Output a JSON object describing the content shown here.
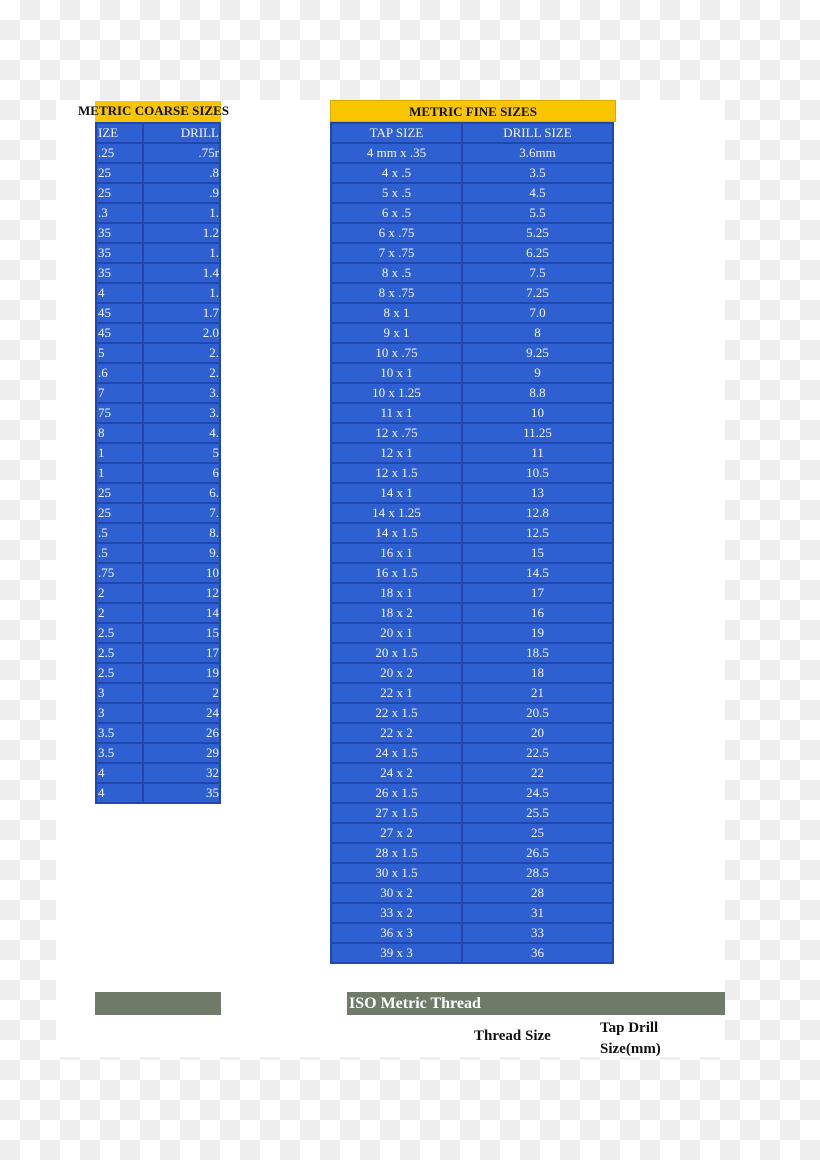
{
  "coarse": {
    "title": "METRIC COARSE SIZES",
    "header": [
      "IZE",
      "DRILL"
    ],
    "rows": [
      [
        ".25",
        ".75r"
      ],
      [
        "25",
        ".8"
      ],
      [
        "25",
        ".9"
      ],
      [
        ".3",
        "1."
      ],
      [
        "35",
        "1.2"
      ],
      [
        "35",
        "1."
      ],
      [
        "35",
        "1.4"
      ],
      [
        "4",
        "1."
      ],
      [
        "45",
        "1.7"
      ],
      [
        "45",
        "2.0"
      ],
      [
        "5",
        "2."
      ],
      [
        ".6",
        "2."
      ],
      [
        "7",
        "3."
      ],
      [
        "75",
        "3."
      ],
      [
        "8",
        "4."
      ],
      [
        "1",
        "5"
      ],
      [
        "1",
        "6"
      ],
      [
        "25",
        "6."
      ],
      [
        "25",
        "7."
      ],
      [
        ".5",
        "8."
      ],
      [
        ".5",
        "9."
      ],
      [
        ".75",
        "10"
      ],
      [
        "2",
        "12"
      ],
      [
        "2",
        "14"
      ],
      [
        "2.5",
        "15"
      ],
      [
        "2.5",
        "17"
      ],
      [
        "2.5",
        "19"
      ],
      [
        "3",
        "2"
      ],
      [
        "3",
        "24"
      ],
      [
        "3.5",
        "26"
      ],
      [
        "3.5",
        "29"
      ],
      [
        "4",
        "32"
      ],
      [
        "4",
        "35"
      ]
    ]
  },
  "fine": {
    "title": "METRIC FINE SIZES",
    "header": [
      "TAP SIZE",
      "DRILL SIZE"
    ],
    "rows": [
      [
        "4 mm x .35",
        "3.6mm"
      ],
      [
        "4 x .5",
        "3.5"
      ],
      [
        "5 x .5",
        "4.5"
      ],
      [
        "6 x .5",
        "5.5"
      ],
      [
        "6 x .75",
        "5.25"
      ],
      [
        "7 x .75",
        "6.25"
      ],
      [
        "8 x .5",
        "7.5"
      ],
      [
        "8 x .75",
        "7.25"
      ],
      [
        "8 x 1",
        "7.0"
      ],
      [
        "9 x 1",
        "8"
      ],
      [
        "10 x .75",
        "9.25"
      ],
      [
        "10 x 1",
        "9"
      ],
      [
        "10 x 1.25",
        "8.8"
      ],
      [
        "11 x 1",
        "10"
      ],
      [
        "12 x .75",
        "11.25"
      ],
      [
        "12 x 1",
        "11"
      ],
      [
        "12 x 1.5",
        "10.5"
      ],
      [
        "14 x 1",
        "13"
      ],
      [
        "14 x 1.25",
        "12.8"
      ],
      [
        "14 x 1.5",
        "12.5"
      ],
      [
        "16 x 1",
        "15"
      ],
      [
        "16 x 1.5",
        "14.5"
      ],
      [
        "18 x 1",
        "17"
      ],
      [
        "18 x 2",
        "16"
      ],
      [
        "20 x 1",
        "19"
      ],
      [
        "20 x 1.5",
        "18.5"
      ],
      [
        "20 x 2",
        "18"
      ],
      [
        "22 x 1",
        "21"
      ],
      [
        "22 x 1.5",
        "20.5"
      ],
      [
        "22 x 2",
        "20"
      ],
      [
        "24 x 1.5",
        "22.5"
      ],
      [
        "24 x 2",
        "22"
      ],
      [
        "26 x 1.5",
        "24.5"
      ],
      [
        "27 x 1.5",
        "25.5"
      ],
      [
        "27 x 2",
        "25"
      ],
      [
        "28 x 1.5",
        "26.5"
      ],
      [
        "30 x 1.5",
        "28.5"
      ],
      [
        "30 x 2",
        "28"
      ],
      [
        "33 x 2",
        "31"
      ],
      [
        "36 x 3",
        "33"
      ],
      [
        "39 x 3",
        "36"
      ]
    ]
  },
  "iso": {
    "title": "ISO Metric Thread",
    "thread_size_label": "Thread Size",
    "tap_drill_label_line1": "Tap Drill",
    "tap_drill_label_line2": "Size(mm)"
  },
  "colors": {
    "cell_blue": "#2f60d2",
    "border_blue": "#1f47ae",
    "header_yellow": "#f8c500",
    "bar_gray_green": "#6f7a68"
  }
}
